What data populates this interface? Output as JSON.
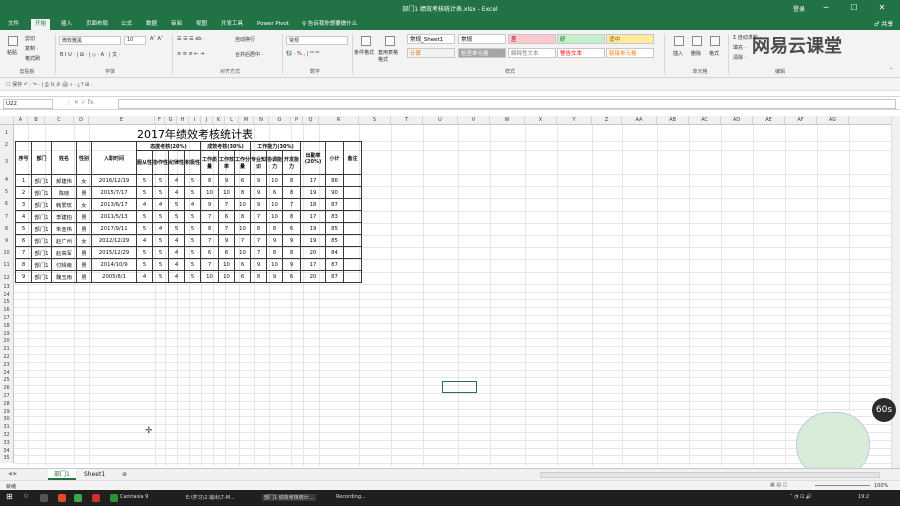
{
  "window": {
    "title": "部门1 绩效考核统计表.xlsx - Excel",
    "user": "登录",
    "controls": [
      "─",
      "☐",
      "✕"
    ]
  },
  "ribbon_tabs": [
    "文件",
    "开始",
    "插入",
    "页面布局",
    "公式",
    "数据",
    "审阅",
    "视图",
    "开发工具",
    "Power Pivot",
    "♀ 告诉我你想要做什么"
  ],
  "share_label": "♂ 共享",
  "ribbon": {
    "clipboard": {
      "paste": "粘贴",
      "cut": "剪切",
      "copy": "复制 ·",
      "format_painter": "格式刷",
      "label": "剪贴板"
    },
    "font": {
      "name": "微软雅黑",
      "size": "10",
      "label": "字体",
      "row2": "B  I  U · | ⊞ · | ◇ · A · | 文 ·"
    },
    "alignment": {
      "wrap": "自动换行",
      "merge": "合并后居中 ·",
      "label": "对齐方式"
    },
    "number": {
      "format": "常规",
      "row2": "💱 · % , | ⁰⁰ ⁰⁰",
      "label": "数字"
    },
    "styles": {
      "conditional": "条件格式",
      "table": "套用表格格式",
      "label": "样式",
      "cells": [
        {
          "text": "常规_Sheet1",
          "bg": "#ffffff",
          "color": "#000000"
        },
        {
          "text": "常规",
          "bg": "#ffffff",
          "color": "#000000"
        },
        {
          "text": "差",
          "bg": "#ffc7ce",
          "color": "#9c0006"
        },
        {
          "text": "好",
          "bg": "#c6efce",
          "color": "#006100"
        },
        {
          "text": "适中",
          "bg": "#ffeb9c",
          "color": "#9c5700"
        },
        {
          "text": "计算",
          "bg": "#f2f2f2",
          "color": "#fa7d00"
        },
        {
          "text": "检查单元格",
          "bg": "#a5a5a5",
          "color": "#ffffff"
        },
        {
          "text": "解释性文本",
          "bg": "#ffffff",
          "color": "#7f7f7f"
        },
        {
          "text": "警告文本",
          "bg": "#ffffff",
          "color": "#ff0000"
        },
        {
          "text": "链接单元格",
          "bg": "#ffffff",
          "color": "#fa7d00"
        }
      ]
    },
    "cells_group": {
      "insert": "插入",
      "delete": "删除",
      "format": "格式",
      "label": "单元格"
    },
    "editing": {
      "autosum": "Σ 自动求和 ·",
      "fill": "填充 ·",
      "clear": "清除 ·",
      "label": "编辑"
    }
  },
  "qat": "☐ 保存 ↶ · ↷ · | ⎙ ⇅ ⇵ 🖨 ⌕ · ⤓ ⤒ ⊞ ·",
  "formula_bar": {
    "name_box": "U22",
    "icons": "⋮   ✕   ✓   fx",
    "value": ""
  },
  "watermark": "网易云课堂",
  "columns": [
    "A",
    "B",
    "C",
    "D",
    "E",
    "F",
    "G",
    "H",
    "I",
    "J",
    "K",
    "L",
    "M",
    "N",
    "O",
    "P",
    "Q",
    "R",
    "S",
    "T",
    "U",
    "V",
    "W",
    "X",
    "Y",
    "Z",
    "AA",
    "AB",
    "AC",
    "AD",
    "AE",
    "AF",
    "AG"
  ],
  "sheet": {
    "title": "2017年绩效考核统计表",
    "group_headers": [
      "态度考核(20%)",
      "成效考核(30%)",
      "工作能力(30%)"
    ],
    "headers": [
      "序号",
      "部门",
      "姓名",
      "性别",
      "入职时间",
      "服从性",
      "协作性",
      "纪律性",
      "积极性",
      "工作质量",
      "工作效率",
      "工作分量",
      "专业知识",
      "协调能力",
      "开发能力",
      "出勤率(20%)",
      "小计",
      "备注"
    ],
    "rows": [
      [
        "1",
        "部门1",
        "郝建伟",
        "女",
        "2016/12/19",
        "5",
        "5",
        "4",
        "5",
        "8",
        "9",
        "6",
        "9",
        "10",
        "8",
        "17",
        "86",
        ""
      ],
      [
        "2",
        "部门1",
        "陈晓",
        "男",
        "2015/7/17",
        "5",
        "5",
        "4",
        "5",
        "10",
        "10",
        "8",
        "9",
        "6",
        "8",
        "19",
        "90",
        ""
      ],
      [
        "3",
        "部门1",
        "韩爱玫",
        "女",
        "2013/6/17",
        "4",
        "4",
        "5",
        "4",
        "9",
        "7",
        "10",
        "9",
        "10",
        "7",
        "18",
        "87",
        ""
      ],
      [
        "4",
        "部门1",
        "李建柏",
        "男",
        "2011/5/13",
        "5",
        "5",
        "5",
        "5",
        "7",
        "6",
        "8",
        "7",
        "10",
        "8",
        "17",
        "83",
        ""
      ],
      [
        "5",
        "部门1",
        "朱亚伟",
        "男",
        "2017/9/11",
        "5",
        "4",
        "5",
        "5",
        "8",
        "7",
        "10",
        "8",
        "8",
        "6",
        "19",
        "85",
        ""
      ],
      [
        "6",
        "部门1",
        "赵广州",
        "女",
        "2012/12/29",
        "4",
        "5",
        "4",
        "5",
        "7",
        "9",
        "7",
        "7",
        "9",
        "9",
        "19",
        "85",
        ""
      ],
      [
        "7",
        "部门1",
        "赵高军",
        "男",
        "2015/12/29",
        "5",
        "5",
        "4",
        "5",
        "6",
        "6",
        "10",
        "7",
        "8",
        "8",
        "20",
        "84",
        ""
      ],
      [
        "8",
        "部门1",
        "付晴南",
        "男",
        "2014/10/9",
        "5",
        "5",
        "4",
        "5",
        "7",
        "10",
        "6",
        "9",
        "10",
        "9",
        "17",
        "87",
        ""
      ],
      [
        "9",
        "部门1",
        "魏玉雨",
        "男",
        "2005/8/1",
        "4",
        "5",
        "4",
        "5",
        "10",
        "10",
        "6",
        "8",
        "9",
        "6",
        "20",
        "87",
        ""
      ]
    ]
  },
  "sheet_tabs": [
    "部门1",
    "Sheet1"
  ],
  "add_sheet": "⊕",
  "status": {
    "ready": "就绪",
    "zoom": "100%"
  },
  "badge": "60s",
  "taskbar": {
    "items": [
      "Camtasia 9",
      "E:\\学习\\2.输出\\7-M...",
      "部门1 绩效考核统计...",
      "Recording..."
    ],
    "time": "19:2"
  },
  "colors": {
    "accent": "#217346",
    "taskbar": "#1f1f1f"
  }
}
